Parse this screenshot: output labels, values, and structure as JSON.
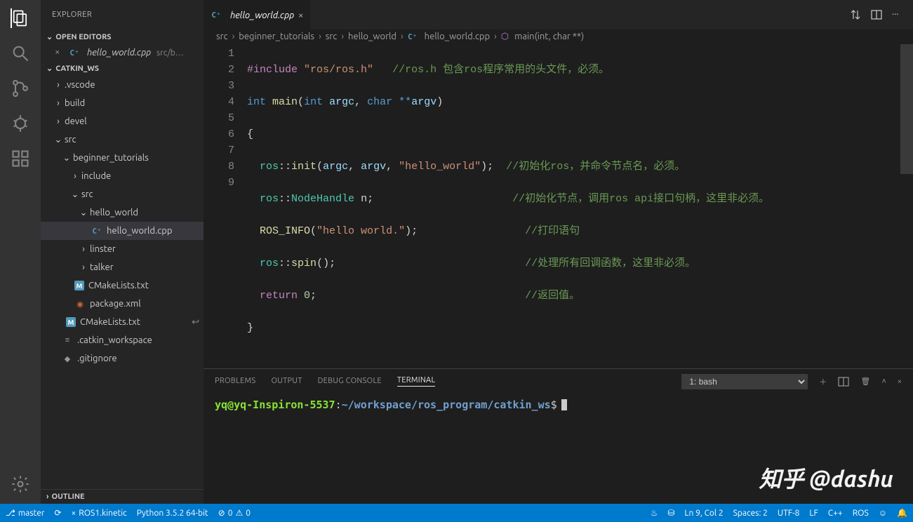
{
  "sidebar_title": "EXPLORER",
  "sections": {
    "open_editors": "OPEN EDITORS",
    "workspace": "CATKIN_WS",
    "outline": "OUTLINE"
  },
  "open_editor": {
    "name": "hello_world.cpp",
    "path": "src/b…"
  },
  "tree": {
    "vscode": ".vscode",
    "build": "build",
    "devel": "devel",
    "src": "src",
    "beginner": "beginner_tutorials",
    "include": "include",
    "src2": "src",
    "hello_world_dir": "hello_world",
    "hello_world_file": "hello_world.cpp",
    "linster": "linster",
    "talker": "talker",
    "cmake1": "CMakeLists.txt",
    "package": "package.xml",
    "cmake2": "CMakeLists.txt",
    "catkin_ws": ".catkin_workspace",
    "gitignore": ".gitignore"
  },
  "tab": {
    "name": "hello_world.cpp"
  },
  "breadcrumbs": {
    "b1": "src",
    "b2": "beginner_tutorials",
    "b3": "src",
    "b4": "hello_world",
    "b5": "hello_world.cpp",
    "b6": "main(int, char **)"
  },
  "code": {
    "l1_pp": "#include",
    "l1_str": "\"ros/ros.h\"",
    "l1_cmt": "//ros.h 包含ros程序常用的头文件，必须。",
    "l2_kw1": "int",
    "l2_fn": "main",
    "l2_p1": "(",
    "l2_kw2": "int",
    "l2_v1": "argc",
    "l2_c1": ",",
    "l2_kw3": "char",
    "l2_op": "**",
    "l2_v2": "argv",
    "l2_p2": ")",
    "l3": "{",
    "l4_ns": "ros",
    "l4_sep": "::",
    "l4_fn": "init",
    "l4_p1": "(",
    "l4_a1": "argc",
    "l4_c1": ", ",
    "l4_a2": "argv",
    "l4_c2": ", ",
    "l4_str": "\"hello_world\"",
    "l4_p2": ");",
    "l4_cmt": "//初始化ros，并命令节点名，必须。",
    "l5_ns": "ros",
    "l5_sep": "::",
    "l5_cls": "NodeHandle",
    "l5_v": " n;",
    "l5_cmt": "//初始化节点，调用ros api接口句柄，这里非必须。",
    "l6_fn": "ROS_INFO",
    "l6_p1": "(",
    "l6_str": "\"hello world.\"",
    "l6_p2": ");",
    "l6_cmt": "//打印语句",
    "l7_ns": "ros",
    "l7_sep": "::",
    "l7_fn": "spin",
    "l7_p": "();",
    "l7_cmt": "//处理所有回调函数，这里非必须。",
    "l8_kw": "return",
    "l8_n": " 0",
    "l8_p": ";",
    "l8_cmt": "//返回值。",
    "l9": "}"
  },
  "lines": {
    "n1": "1",
    "n2": "2",
    "n3": "3",
    "n4": "4",
    "n5": "5",
    "n6": "6",
    "n7": "7",
    "n8": "8",
    "n9": "9"
  },
  "panel": {
    "problems": "PROBLEMS",
    "output": "OUTPUT",
    "debug": "DEBUG CONSOLE",
    "terminal": "TERMINAL",
    "shell": "1: bash",
    "prompt_user": "yq@yq-Inspiron-5537",
    "prompt_sep": ":",
    "prompt_path": "~/workspace/ros_program/catkin_ws",
    "prompt_dollar": "$"
  },
  "status": {
    "branch": "master",
    "ros": "ROS1.kinetic",
    "python": "Python 3.5.2 64-bit",
    "err": "0",
    "warn": "0",
    "pos": "Ln 9, Col 2",
    "spaces": "Spaces: 2",
    "enc": "UTF-8",
    "eol": "LF",
    "lang": "C++",
    "rosr": "ROS"
  },
  "watermark": "知乎 @dashu"
}
